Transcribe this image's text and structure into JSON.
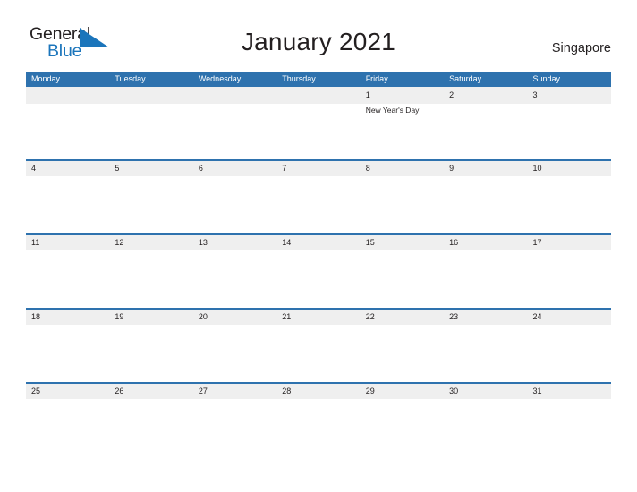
{
  "brand": {
    "word_one": "General",
    "word_two": "Blue",
    "flag_icon": "blue-triangle-flag-icon",
    "color_dark": "#231f20",
    "color_blue": "#1b75bb"
  },
  "header": {
    "title": "January 2021",
    "locale": "Singapore"
  },
  "theme": {
    "header_blue": "#2e72ae",
    "date_band_gray": "#efefef",
    "row_divider_blue": "#2e72ae",
    "text_dark": "#231f20",
    "page_background": "#ffffff"
  },
  "weekdays": [
    "Monday",
    "Tuesday",
    "Wednesday",
    "Thursday",
    "Friday",
    "Saturday",
    "Sunday"
  ],
  "weeks": [
    {
      "days": [
        {
          "date": "",
          "events": []
        },
        {
          "date": "",
          "events": []
        },
        {
          "date": "",
          "events": []
        },
        {
          "date": "",
          "events": []
        },
        {
          "date": "1",
          "events": [
            "New Year's Day"
          ]
        },
        {
          "date": "2",
          "events": []
        },
        {
          "date": "3",
          "events": []
        }
      ]
    },
    {
      "days": [
        {
          "date": "4",
          "events": []
        },
        {
          "date": "5",
          "events": []
        },
        {
          "date": "6",
          "events": []
        },
        {
          "date": "7",
          "events": []
        },
        {
          "date": "8",
          "events": []
        },
        {
          "date": "9",
          "events": []
        },
        {
          "date": "10",
          "events": []
        }
      ]
    },
    {
      "days": [
        {
          "date": "11",
          "events": []
        },
        {
          "date": "12",
          "events": []
        },
        {
          "date": "13",
          "events": []
        },
        {
          "date": "14",
          "events": []
        },
        {
          "date": "15",
          "events": []
        },
        {
          "date": "16",
          "events": []
        },
        {
          "date": "17",
          "events": []
        }
      ]
    },
    {
      "days": [
        {
          "date": "18",
          "events": []
        },
        {
          "date": "19",
          "events": []
        },
        {
          "date": "20",
          "events": []
        },
        {
          "date": "21",
          "events": []
        },
        {
          "date": "22",
          "events": []
        },
        {
          "date": "23",
          "events": []
        },
        {
          "date": "24",
          "events": []
        }
      ]
    },
    {
      "days": [
        {
          "date": "25",
          "events": []
        },
        {
          "date": "26",
          "events": []
        },
        {
          "date": "27",
          "events": []
        },
        {
          "date": "28",
          "events": []
        },
        {
          "date": "29",
          "events": []
        },
        {
          "date": "30",
          "events": []
        },
        {
          "date": "31",
          "events": []
        }
      ]
    }
  ]
}
